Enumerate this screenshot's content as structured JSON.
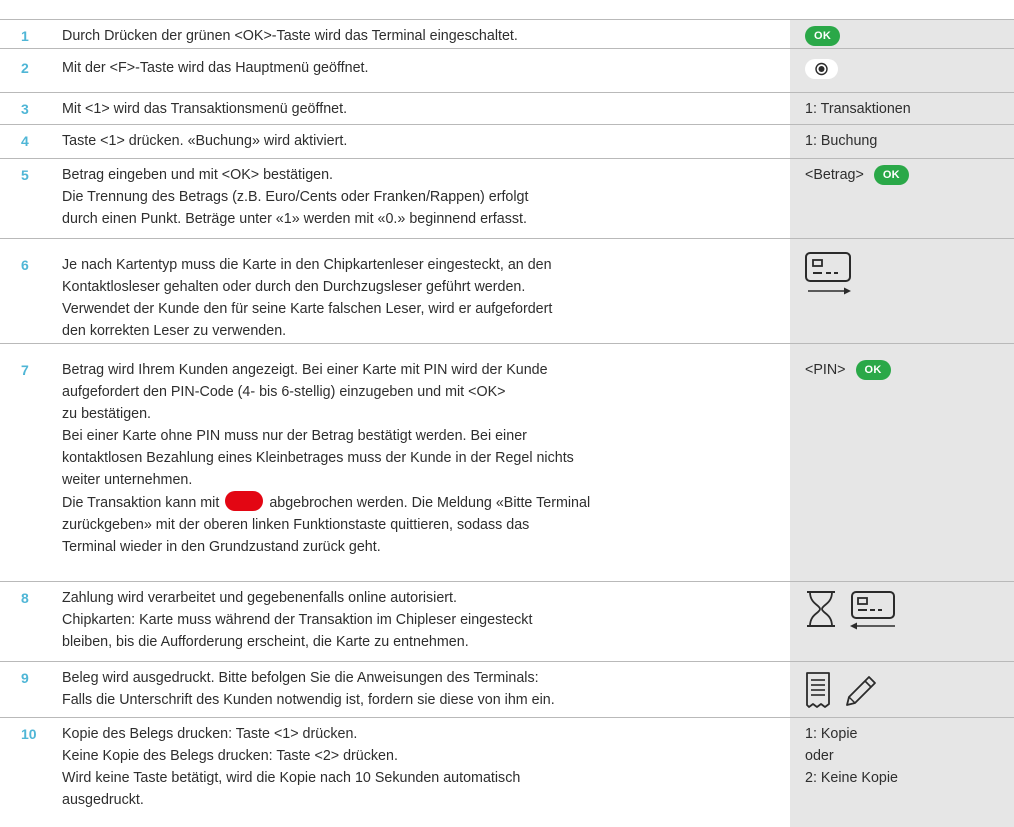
{
  "steps": [
    {
      "num": "1",
      "lines": [
        "Durch Drücken der grünen <OK>-Taste wird das Terminal eingeschaltet."
      ],
      "side": {
        "type": "ok",
        "ok_label": "OK"
      }
    },
    {
      "num": "2",
      "lines": [
        "Mit der <F>-Taste wird das Hauptmenü geöffnet."
      ],
      "side": {
        "type": "f-key-icon"
      }
    },
    {
      "num": "3",
      "lines": [
        "Mit <1> wird das Transaktionsmenü geöffnet."
      ],
      "side": {
        "type": "text",
        "lines": [
          "1: Transaktionen"
        ]
      }
    },
    {
      "num": "4",
      "lines": [
        "Taste <1> drücken. «Buchung» wird aktiviert."
      ],
      "side": {
        "type": "text",
        "lines": [
          "1: Buchung"
        ]
      }
    },
    {
      "num": "5",
      "lines": [
        "Betrag eingeben und mit <OK> bestätigen.",
        "Die Trennung des Betrags (z.B. Euro/Cents oder Franken/Rappen) erfolgt",
        "durch einen Punkt. Beträge unter «1» werden mit «0.» beginnend erfasst."
      ],
      "side": {
        "type": "text-ok",
        "text": "<Betrag>",
        "ok_label": "OK"
      }
    },
    {
      "num": "6",
      "lines": [
        "Je nach Kartentyp muss die Karte in den Chipkartenleser eingesteckt, an den",
        "Kontaktlosleser gehalten oder durch den Durchzugsleser geführt werden.",
        "Verwendet der Kunde den für seine Karte falschen Leser, wird er aufgefordert",
        "den korrekten Leser zu verwenden."
      ],
      "side": {
        "type": "card-insert-icon"
      }
    },
    {
      "num": "7",
      "lines": [
        "Betrag wird Ihrem Kunden angezeigt. Bei einer Karte mit PIN wird der Kunde",
        "aufgefordert den PIN-Code (4- bis 6-stellig) einzugeben und mit <OK>",
        "zu bestätigen.",
        "Bei einer Karte ohne PIN muss nur der Betrag bestätigt werden. Bei einer",
        "kontaktlosen Bezahlung eines Kleinbetrages muss der Kunde in der Regel nichts",
        "weiter unternehmen."
      ],
      "cancel_before": "Die Transaktion kann mit",
      "cancel_after": "abgebrochen werden. Die Meldung «Bitte Terminal",
      "lines_after": [
        "zurückgeben» mit der oberen linken Funktionstaste quittieren, sodass das",
        "Terminal wieder in den Grundzustand zurück geht."
      ],
      "side": {
        "type": "text-ok",
        "text": "<PIN>",
        "ok_label": "OK"
      }
    },
    {
      "num": "8",
      "lines": [
        "Zahlung wird verarbeitet und gegebenenfalls online autorisiert.",
        "Chipkarten: Karte muss während der Transaktion im Chipleser eingesteckt",
        "bleiben, bis die Aufforderung erscheint, die Karte zu entnehmen."
      ],
      "side": {
        "type": "hourglass-card-remove-icons"
      }
    },
    {
      "num": "9",
      "lines": [
        "Beleg wird ausgedruckt. Bitte befolgen Sie die Anweisungen des Terminals:",
        "Falls die Unterschrift des Kunden notwendig ist, fordern sie diese von ihm ein."
      ],
      "side": {
        "type": "receipt-pen-icons"
      }
    },
    {
      "num": "10",
      "lines": [
        "Kopie des Belegs drucken: Taste <1> drücken.",
        "Keine Kopie des Belegs drucken: Taste <2> drücken.",
        "Wird keine Taste betätigt, wird die Kopie nach 10 Sekunden automatisch",
        "ausgedruckt."
      ],
      "side": {
        "type": "text",
        "lines": [
          "1: Kopie",
          "oder",
          "2: Keine Kopie"
        ]
      }
    }
  ],
  "colors": {
    "step_number": "#4fb6d6",
    "ok_button": "#2aa848",
    "cancel_button": "#e30613",
    "side_panel": "#e6e6e6"
  }
}
